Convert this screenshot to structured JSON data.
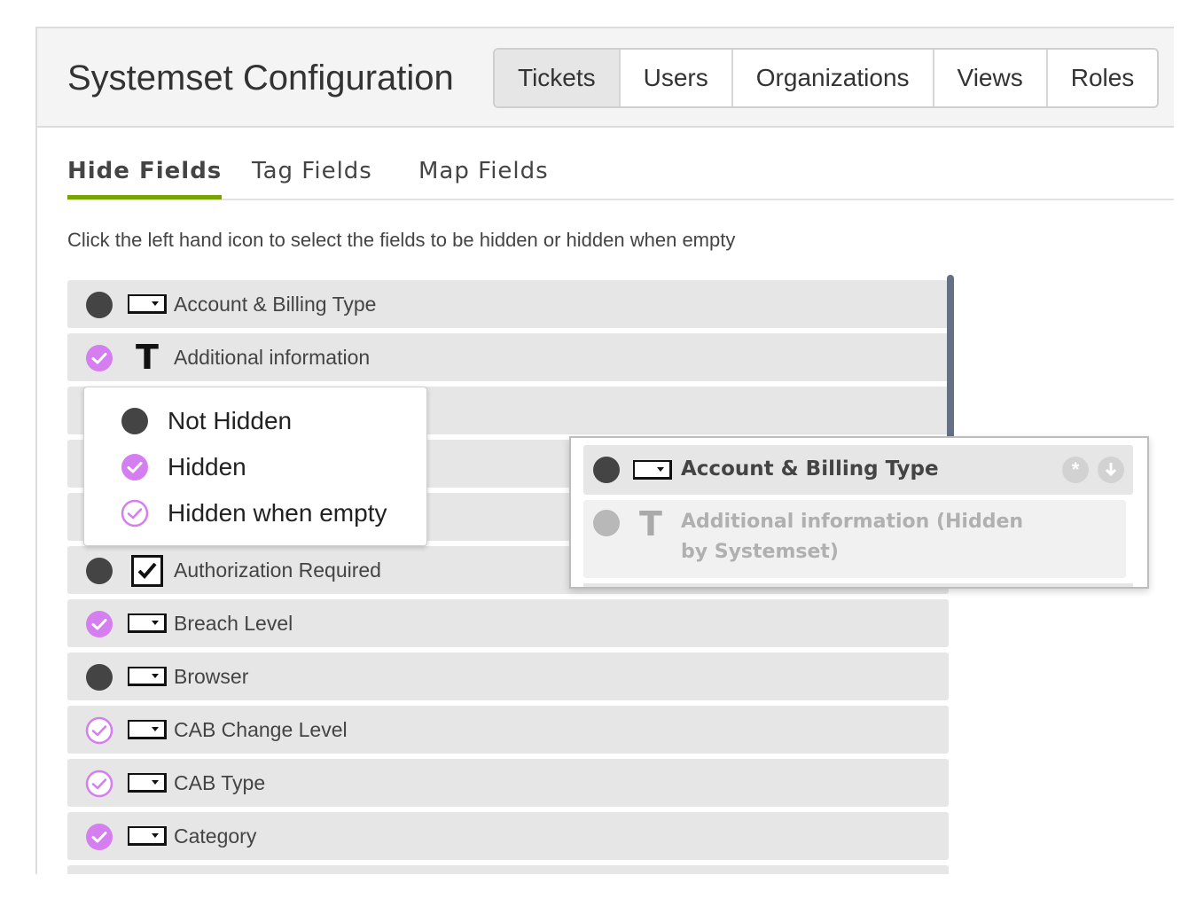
{
  "header": {
    "title": "Systemset Configuration",
    "tabs": [
      {
        "label": "Tickets",
        "active": true
      },
      {
        "label": "Users",
        "active": false
      },
      {
        "label": "Organizations",
        "active": false
      },
      {
        "label": "Views",
        "active": false
      },
      {
        "label": "Roles",
        "active": false
      }
    ]
  },
  "subtabs": [
    {
      "label": "Hide Fields",
      "active": true
    },
    {
      "label": "Tag Fields",
      "active": false
    },
    {
      "label": "Map Fields",
      "active": false
    }
  ],
  "instruction": "Click the left hand icon to select the fields to be hidden or hidden when empty",
  "colors": {
    "accent_green": "#78a300",
    "hidden_purple": "#d57ef0",
    "not_hidden_dark": "#444444",
    "row_bg": "#e6e6e6",
    "scrollbar": "#657084"
  },
  "fields": [
    {
      "label": "Account & Billing Type",
      "status": "not-hidden",
      "type_icon": "dropdown-icon"
    },
    {
      "label": "Additional information",
      "status": "hidden",
      "type_icon": "text-icon"
    },
    {
      "label": "",
      "status": "not-hidden",
      "type_icon": "dropdown-icon"
    },
    {
      "label": "",
      "status": "not-hidden",
      "type_icon": "dropdown-icon"
    },
    {
      "label": "",
      "status": "not-hidden",
      "type_icon": "dropdown-icon"
    },
    {
      "label": "Authorization Required",
      "status": "not-hidden",
      "type_icon": "checkbox-icon"
    },
    {
      "label": "Breach Level",
      "status": "hidden",
      "type_icon": "dropdown-icon"
    },
    {
      "label": "Browser",
      "status": "not-hidden",
      "type_icon": "dropdown-icon"
    },
    {
      "label": "CAB Change Level",
      "status": "hidden-when-empty",
      "type_icon": "dropdown-icon"
    },
    {
      "label": "CAB Type",
      "status": "hidden-when-empty",
      "type_icon": "dropdown-icon"
    },
    {
      "label": "Category",
      "status": "hidden",
      "type_icon": "dropdown-icon"
    }
  ],
  "status_menu": {
    "options": [
      {
        "label": "Not Hidden",
        "icon": "not-hidden-icon"
      },
      {
        "label": "Hidden",
        "icon": "hidden-icon"
      },
      {
        "label": "Hidden when empty",
        "icon": "hidden-when-empty-icon"
      }
    ]
  },
  "drag_preview": {
    "row1_label": "Account & Billing Type",
    "row2_label_line1": "Additional information (Hidden",
    "row2_label_line2": "by Systemset)",
    "icons": [
      "asterisk-icon",
      "arrow-down-icon"
    ]
  }
}
